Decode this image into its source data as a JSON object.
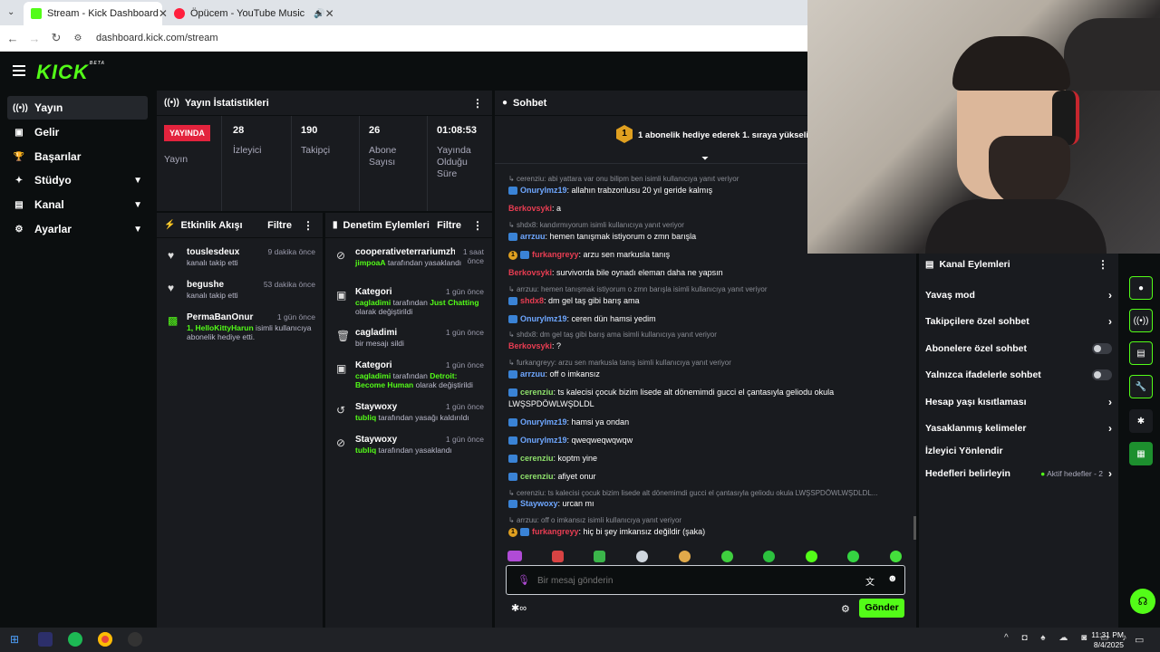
{
  "browser": {
    "tabs": [
      {
        "label": "Stream - Kick Dashboard",
        "active": true
      },
      {
        "label": "Öpücem - YouTube Music",
        "active": false
      }
    ],
    "url": "dashboard.kick.com/stream"
  },
  "brand": {
    "logo": "KICK",
    "beta": "BETA",
    "accent": "#53fc18"
  },
  "sidebar": {
    "items": [
      {
        "label": "Yayın",
        "icon": "broadcast-icon"
      },
      {
        "label": "Gelir",
        "icon": "revenue-icon"
      },
      {
        "label": "Başarılar",
        "icon": "trophy-icon"
      },
      {
        "label": "Stüdyo",
        "icon": "studio-icon"
      },
      {
        "label": "Kanal",
        "icon": "channel-icon"
      },
      {
        "label": "Ayarlar",
        "icon": "gear-icon"
      }
    ]
  },
  "stats": {
    "title": "Yayın İstatistikleri",
    "live_badge": "YAYINDA",
    "live_label": "Yayın",
    "viewers": {
      "value": "28",
      "label": "İzleyici"
    },
    "followers": {
      "value": "190",
      "label": "Takipçi"
    },
    "subs": {
      "value": "26",
      "label": "Abone Sayısı"
    },
    "uptime": {
      "value": "01:08:53",
      "label": "Yayında Olduğu Süre"
    }
  },
  "activity": {
    "title": "Etkinlik Akışı",
    "filter": "Filtre",
    "items": [
      {
        "name": "touslesdeux",
        "time": "9 dakika önce",
        "desc": "kanalı takip etti"
      },
      {
        "name": "begushe",
        "time": "53 dakika önce",
        "desc": "kanalı takip etti"
      },
      {
        "name": "PermaBanOnur",
        "time": "1 gün önce",
        "desc_green": "1, HelloKittyHarun",
        "desc": " isimli kullanıcıya abonelik hediye etti."
      }
    ]
  },
  "moderation": {
    "title": "Denetim Eylemleri",
    "filter": "Filtre",
    "items": [
      {
        "name": "cooperativeterrariumzh",
        "time": "1 saat önce",
        "actor": "jimpoaA",
        "desc": " tarafından yasaklandı"
      },
      {
        "name": "Kategori",
        "time": "1 gün önce",
        "actor": "cagladimi",
        "desc": " tarafından ",
        "extra": "Just Chatting",
        "desc2": " olarak değiştirildi"
      },
      {
        "name": "cagladimi",
        "time": "1 gün önce",
        "desc": "bir mesajı sildi"
      },
      {
        "name": "Kategori",
        "time": "1 gün önce",
        "actor": "cagladimi",
        "desc": " tarafından ",
        "extra": "Detroit: Become Human",
        "desc2": " olarak değiştirildi"
      },
      {
        "name": "Staywoxy",
        "time": "1 gün önce",
        "actor": "tubliq",
        "desc": " tarafından yasağı kaldırıldı"
      },
      {
        "name": "Staywoxy",
        "time": "1 gün önce",
        "actor": "tubliq",
        "desc": " tarafından yasaklandı"
      }
    ]
  },
  "chat": {
    "title": "Sohbet",
    "pinned_rank": "1",
    "pinned_text": "1 abonelik hediye ederek 1. sıraya yükselin",
    "messages": [
      {
        "reply": "cerenziu: abi yattara var onu bilipm ben isimli kullanıcıya yanıt veriyor",
        "user": "Onurylmz19",
        "text": ": allahın trabzonlusu 20 yıl geride kalmış",
        "color": "blue",
        "badge": "blue"
      },
      {
        "user": "Berkovsyki",
        "text": ": a",
        "color": "red"
      },
      {
        "reply": "shdx8: kandırmıyorum isimli kullanıcıya yanıt veriyor",
        "user": "arrzuu",
        "text": ": hemen tanışmak istiyorum o zmn barışla",
        "color": "blue",
        "badge": "blue"
      },
      {
        "user": "furkangreyy",
        "text": ": arzu sen markusla tanış",
        "color": "red",
        "badge": "gold"
      },
      {
        "user": "Berkovsyki",
        "text": ": survivorda bile oynadı eleman daha ne yapsın",
        "color": "red"
      },
      {
        "reply": "arrzuu: hemen tanışmak istiyorum o zmn barışla isimli kullanıcıya yanıt veriyor",
        "user": "shdx8",
        "text": ": dm gel taş gibi barış ama",
        "color": "red",
        "badge": "blue"
      },
      {
        "user": "Onurylmz19",
        "text": ": ceren dün hamsi yedim",
        "color": "blue",
        "badge": "blue"
      },
      {
        "reply": "shdx8: dm gel taş gibi barış ama isimli kullanıcıya yanıt veriyor",
        "user": "Berkovsyki",
        "text": ": ?",
        "color": "red"
      },
      {
        "reply": "furkangreyy: arzu sen markusla tanış isimli kullanıcıya yanıt veriyor",
        "user": "arrzuu",
        "text": ": off o imkansız",
        "color": "blue",
        "badge": "blue"
      },
      {
        "user": "cerenziu",
        "text": ": ts kalecisi çocuk bizim lisede alt dönemimdi gucci el çantasıyla geliodu okula",
        "text2": "LWŞSPDÖWLWŞDLDL",
        "color": "green",
        "badge": "blue"
      },
      {
        "user": "Onurylmz19",
        "text": ": hamsi ya ondan",
        "color": "blue",
        "badge": "blue"
      },
      {
        "user": "Onurylmz19",
        "text": ": qweqweqwqwqw",
        "color": "blue",
        "badge": "blue"
      },
      {
        "user": "cerenziu",
        "text": ": koptm yine",
        "color": "green",
        "badge": "blue"
      },
      {
        "user": "cerenziu",
        "text": ": afiyet onur",
        "color": "green",
        "badge": "blue"
      },
      {
        "reply": "cerenziu: ts kalecisi çocuk bizim lisede alt dönemimdi gucci el çantasıyla geliodu okula LWŞSPDÖWLWŞDLDL...",
        "user": "Staywoxy",
        "text": ": urcan mı",
        "color": "blue",
        "badge": "blue"
      },
      {
        "reply": "arrzuu: off o imkansız isimli kullanıcıya yanıt veriyor",
        "user": "furkangreyy",
        "text": ": hiç bi şey imkansız değildir (şaka)",
        "color": "red",
        "badge": "gold"
      }
    ],
    "input_placeholder": "Bir mesaj gönderin",
    "send_label": "Gönder"
  },
  "channel_actions": {
    "title": "Kanal Eylemleri",
    "items": [
      {
        "label": "Yavaş mod",
        "kind": "chevron"
      },
      {
        "label": "Takipçilere özel sohbet",
        "kind": "chevron"
      },
      {
        "label": "Abonelere özel sohbet",
        "kind": "toggle"
      },
      {
        "label": "Yalnızca ifadelerle sohbet",
        "kind": "toggle"
      },
      {
        "label": "Hesap yaşı kısıtlaması",
        "kind": "chevron"
      },
      {
        "label": "Yasaklanmış kelimeler",
        "kind": "chevron"
      },
      {
        "label": "İzleyici Yönlendir",
        "kind": "none"
      },
      {
        "label": "Hedefleri belirleyin",
        "kind": "chevron",
        "badge": "Aktif hedefler - 2"
      }
    ]
  },
  "taskbar": {
    "time": "11:31 PM",
    "date": "8/4/2025"
  }
}
